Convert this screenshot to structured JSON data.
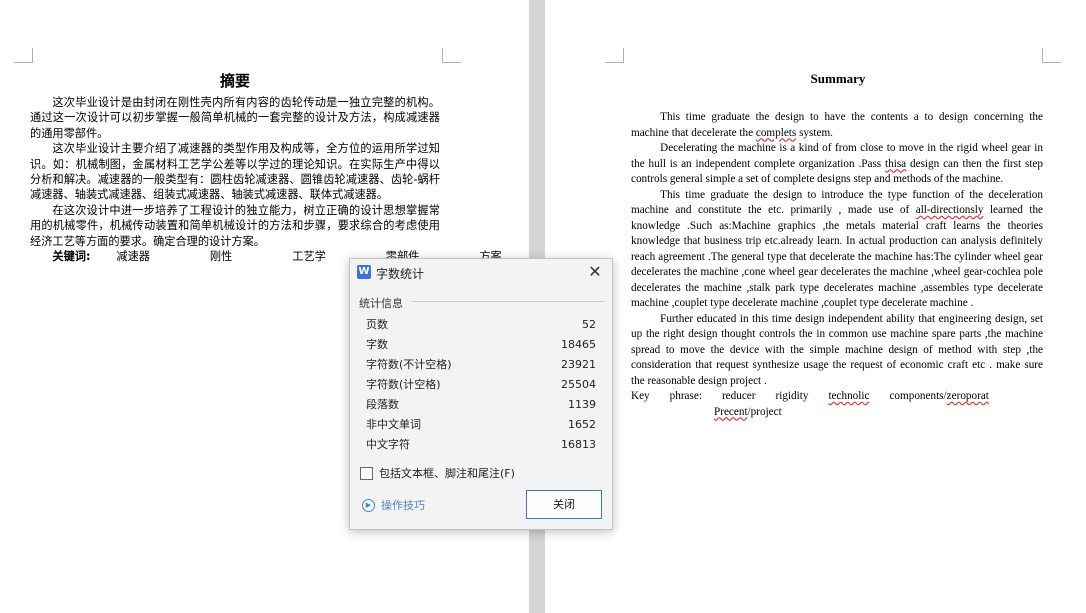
{
  "left_page": {
    "title": "摘要",
    "paragraphs": [
      "这次毕业设计是由封闭在刚性壳内所有内容的齿轮传动是一独立完整的机构。通过这一次设计可以初步掌握一般简单机械的一套完整的设计及方法，构成减速器的通用零部件。",
      "这次毕业设计主要介绍了减速器的类型作用及构成等，全方位的运用所学过知识。如：机械制图，金属材料工艺学公差等以学过的理论知识。在实际生产中得以分析和解决。减速器的一般类型有：圆柱齿轮减速器、圆锥齿轮减速器、齿轮-蜗杆减速器、轴装式减速器、组装式减速器、轴装式减速器、联体式减速器。",
      "在这次设计中进一步培养了工程设计的独立能力，树立正确的设计思想掌握常用的机械零件，机械传动装置和简单机械设计的方法和步骤，要求综合的考虑使用经济工艺等方面的要求。确定合理的设计方案。"
    ],
    "keywords_label": "关键词:",
    "keywords": [
      "减速器",
      "刚性",
      "工艺学",
      "零部件",
      "方案"
    ]
  },
  "right_page": {
    "title": "Summary",
    "p1": "This time graduate the design to have the contents a to design concerning the machine that decelerate the",
    "p1_err": "complets",
    "p1_end": "system.",
    "p2a": "Decelerating the machine is a kind of from close to move in the rigid wheel gear in the hull is an independent complete organization .Pass",
    "p2_err": "thisa",
    "p2b": "design can then the first step controls general simple a set of complete designs step and methods of the machine.",
    "p3a": "This time graduate the design to introduce the type function of the deceleration machine and constitute the etc. primarily , made use of",
    "p3_err": "all-directionsly",
    "p3b": "learned the knowledge .Such as:Machine graphics ,the metals material craft learns the theories knowledge that business trip etc.already learn. In actual production can analysis definitely reach agreement .The general type that decelerate the machine has:The cylinder wheel gear decelerates the machine ,cone wheel gear decelerates the machine ,wheel gear-cochlea pole decelerates the machine ,stalk park type decelerates machine ,assembles type decelerate machine ,couplet type decelerate machine ,couplet type decelerate machine .",
    "p4": "Further educated in this time design independent ability that engineering design, set up the right design thought controls the in common use machine spare parts ,the machine spread to move the device with the simple machine design of method with step ,the consideration that request synthesize usage the request of economic craft etc . make sure the reasonable design project .",
    "kw_label": "Key",
    "kw_phrase": "phrase:",
    "kw1": "reducer",
    "kw2": "rigidity",
    "kw3": "technolic",
    "kw4a": "components/",
    "kw4b": "zeroporat",
    "kw5a": "Precent",
    "kw5b": "/project"
  },
  "dialog": {
    "title": "字数统计",
    "section_label": "统计信息",
    "stats": [
      {
        "label": "页数",
        "value": "52"
      },
      {
        "label": "字数",
        "value": "18465"
      },
      {
        "label": "字符数(不计空格)",
        "value": "23921"
      },
      {
        "label": "字符数(计空格)",
        "value": "25504"
      },
      {
        "label": "段落数",
        "value": "1139"
      },
      {
        "label": "非中文单词",
        "value": "1652"
      },
      {
        "label": "中文字符",
        "value": "16813"
      }
    ],
    "checkbox_label": "包括文本框、脚注和尾注(F)",
    "tips_label": "操作技巧",
    "close_button": "关闭",
    "app_icon": "W"
  }
}
